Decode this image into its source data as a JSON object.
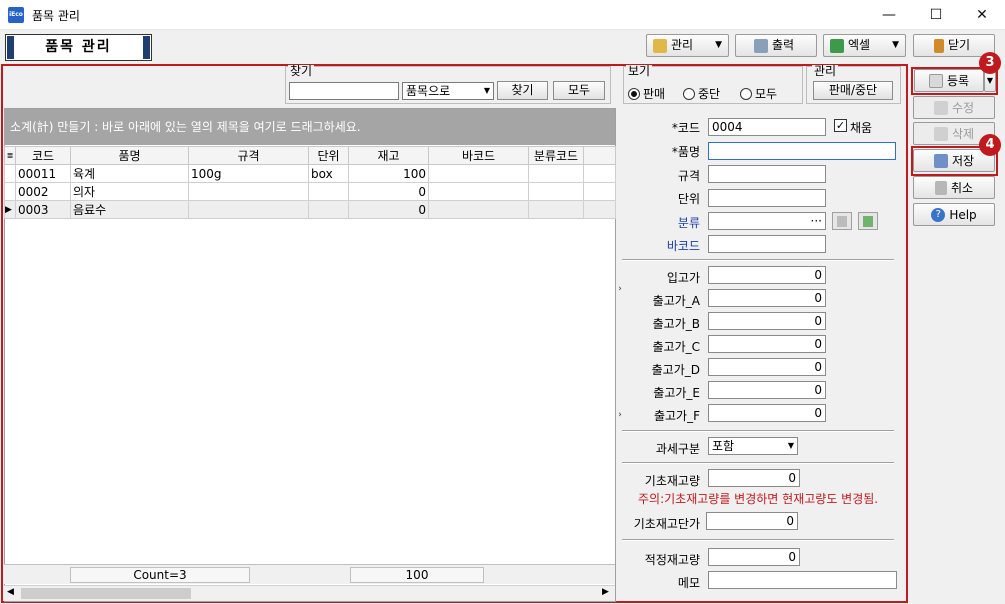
{
  "window": {
    "title": "품목 관리",
    "icon_text": "iEco",
    "minimize": "—",
    "maximize": "☐",
    "close": "✕"
  },
  "header": {
    "title": "품목 관리"
  },
  "toolbar": {
    "manage": "관리",
    "print": "출력",
    "excel": "엑셀",
    "close": "닫기"
  },
  "search": {
    "group_label": "찾기",
    "value": "",
    "field_option": "품목으로",
    "find_button": "찾기",
    "all_button": "모두"
  },
  "view": {
    "group_label": "보기",
    "options": [
      "판매",
      "중단",
      "모두"
    ],
    "selected": "판매"
  },
  "manage_group": {
    "label": "관리",
    "button": "판매/중단"
  },
  "grid": {
    "group_hint": "소계(計) 만들기 : 바로 아래에 있는 열의 제목을 여기로 드래그하세요.",
    "columns": [
      "코드",
      "품명",
      "규격",
      "단위",
      "재고",
      "바코드",
      "분류코드"
    ],
    "rows": [
      [
        "00011",
        "육계",
        "100g",
        "box",
        "100",
        "",
        ""
      ],
      [
        "0002",
        "의자",
        "",
        "",
        "0",
        "",
        ""
      ],
      [
        "0003",
        "음료수",
        "",
        "",
        "0",
        "",
        ""
      ]
    ],
    "footer_count": "Count=3",
    "footer_total": "100"
  },
  "form": {
    "code_label": "*코드",
    "code_value": "0004",
    "auto_label": "채움",
    "name_label": "*품명",
    "name_value": "",
    "spec_label": "규격",
    "unit_label": "단위",
    "category_label": "분류",
    "category_btn": "···",
    "barcode_label": "바코드",
    "in_price_label": "입고가",
    "in_price": "0",
    "out_a_label": "출고가_A",
    "out_a": "0",
    "out_b_label": "출고가_B",
    "out_b": "0",
    "out_c_label": "출고가_C",
    "out_c": "0",
    "out_d_label": "출고가_D",
    "out_d": "0",
    "out_e_label": "출고가_E",
    "out_e": "0",
    "out_f_label": "출고가_F",
    "out_f": "0",
    "tax_label": "과세구분",
    "tax_value": "포함",
    "base_qty_label": "기초재고량",
    "base_qty": "0",
    "warning": "주의:기초재고량를 변경하면 현재고량도 변경됨.",
    "base_price_label": "기초재고단가",
    "base_price": "0",
    "proper_qty_label": "적정재고량",
    "proper_qty": "0",
    "memo_label": "메모",
    "memo_value": ""
  },
  "actions": {
    "register": "등록",
    "edit": "수정",
    "delete": "삭제",
    "save": "저장",
    "cancel": "취소",
    "help": "Help"
  },
  "badges": {
    "b3": "3",
    "b4": "4"
  }
}
